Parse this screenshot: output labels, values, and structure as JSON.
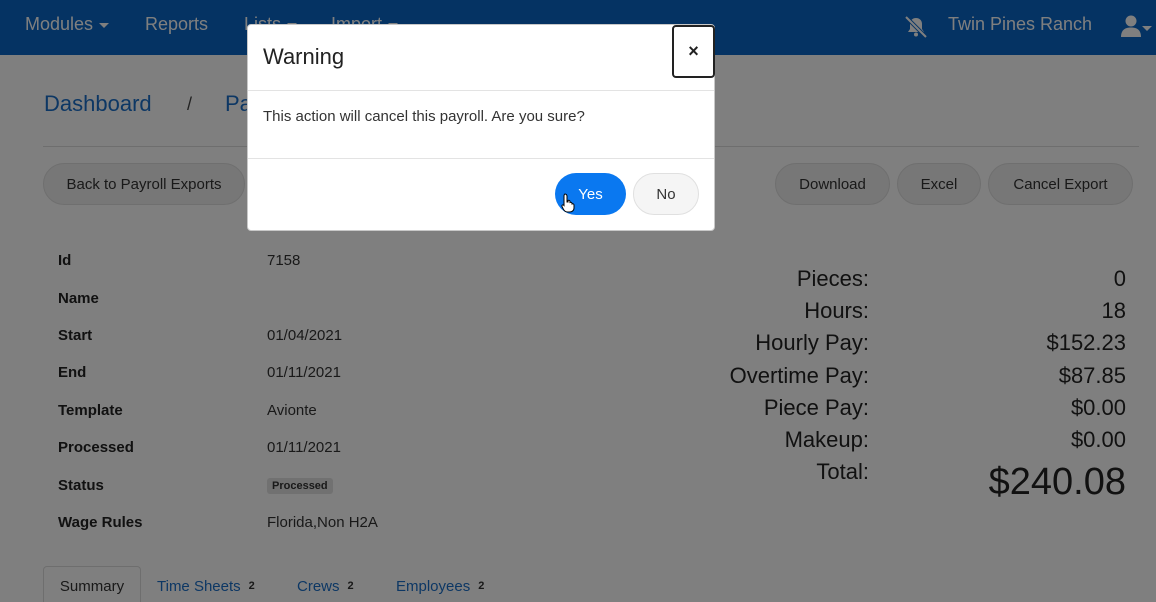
{
  "navbar": {
    "modules": "Modules",
    "reports": "Reports",
    "lists": "Lists",
    "import": "Import",
    "ranch": "Twin Pines Ranch"
  },
  "breadcrumb": {
    "dashboard": "Dashboard",
    "separator": "/",
    "current": "Pa"
  },
  "toolbar": {
    "back": "Back to Payroll Exports",
    "download": "Download",
    "excel": "Excel",
    "cancel_export": "Cancel Export"
  },
  "details": {
    "id_label": "Id",
    "id_value": "7158",
    "name_label": "Name",
    "name_value": "",
    "start_label": "Start",
    "start_value": "01/04/2021",
    "end_label": "End",
    "end_value": "01/11/2021",
    "template_label": "Template",
    "template_value": "Avionte",
    "processed_label": "Processed",
    "processed_value": "01/11/2021",
    "status_label": "Status",
    "status_value": "Processed",
    "wage_label": "Wage Rules",
    "wage_value": "Florida,Non H2A"
  },
  "totals": {
    "pieces_label": "Pieces:",
    "pieces_value": "0",
    "hours_label": "Hours:",
    "hours_value": "18",
    "hourly_label": "Hourly Pay:",
    "hourly_value": "$152.23",
    "overtime_label": "Overtime Pay:",
    "overtime_value": "$87.85",
    "piece_label": "Piece Pay:",
    "piece_value": "$0.00",
    "makeup_label": "Makeup:",
    "makeup_value": "$0.00",
    "total_label": "Total:",
    "total_value": "$240.08"
  },
  "tabs": {
    "summary": "Summary",
    "timesheets": "Time Sheets",
    "timesheets_count": "2",
    "crews": "Crews",
    "crews_count": "2",
    "employees": "Employees",
    "employees_count": "2"
  },
  "modal": {
    "title": "Warning",
    "close": "×",
    "body": "This action will cancel this payroll. Are you sure?",
    "yes": "Yes",
    "no": "No"
  },
  "colors": {
    "navbar": "#0a67c7",
    "link": "#1a6fc9",
    "primary_button": "#0a78f0"
  }
}
